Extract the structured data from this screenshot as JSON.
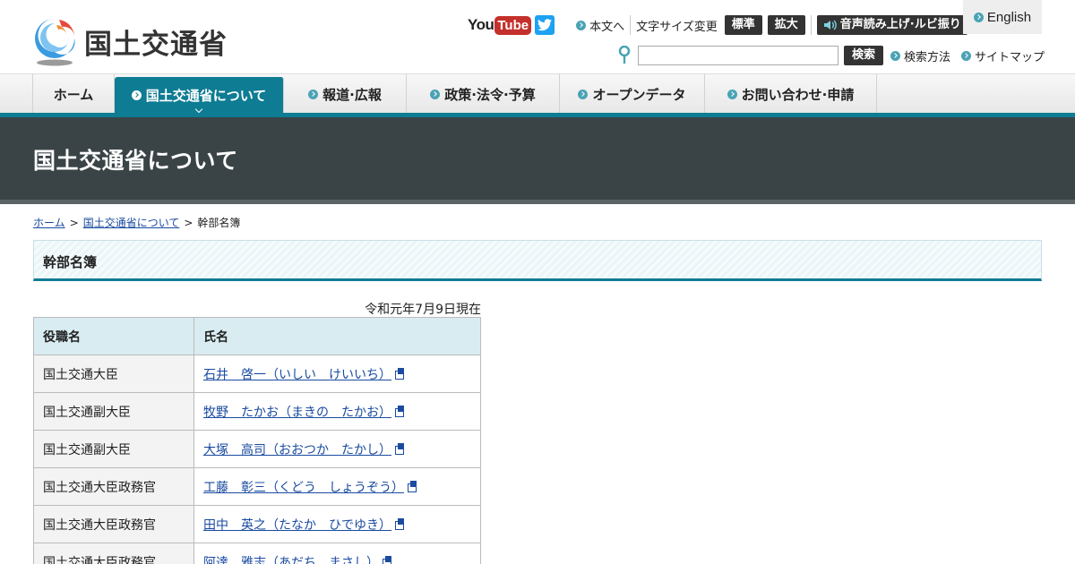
{
  "header": {
    "logo_text": "国土交通省",
    "youtube_you": "You",
    "youtube_tube": "Tube",
    "skip_link": "本文へ",
    "font_size_label": "文字サイズ変更",
    "font_standard": "標準",
    "font_large": "拡大",
    "voice_label": "音声読み上げ·ルビ振り",
    "english": "English",
    "search_button": "検索",
    "search_method": "検索方法",
    "sitemap": "サイトマップ",
    "search_placeholder": ""
  },
  "nav": {
    "items": [
      {
        "label": "ホーム"
      },
      {
        "label": "国土交通省について"
      },
      {
        "label": "報道·広報"
      },
      {
        "label": "政策·法令·予算"
      },
      {
        "label": "オープンデータ"
      },
      {
        "label": "お問い合わせ·申請"
      }
    ]
  },
  "banner": {
    "title": "国土交通省について"
  },
  "breadcrumb": {
    "home": "ホーム",
    "sep": ">",
    "about": "国土交通省について",
    "current": "幹部名簿"
  },
  "section": {
    "title": "幹部名簿",
    "as_of": "令和元年7月9日現在"
  },
  "table": {
    "headers": [
      "役職名",
      "氏名"
    ],
    "rows": [
      {
        "role": "国土交通大臣",
        "name": "石井　啓一（いしい　けいいち）"
      },
      {
        "role": "国土交通副大臣",
        "name": "牧野　たかお（まきの　たかお）"
      },
      {
        "role": "国土交通副大臣",
        "name": "大塚　高司（おおつか　たかし）"
      },
      {
        "role": "国土交通大臣政務官",
        "name": "工藤　彰三（くどう　しょうぞう）"
      },
      {
        "role": "国土交通大臣政務官",
        "name": "田中　英之（たなか　ひでゆき）"
      },
      {
        "role": "国土交通大臣政務官",
        "name": "阿達　雅志（あだち　まさし）"
      }
    ]
  },
  "colors": {
    "accent": "#0e7c93",
    "banner": "#3a4447",
    "link": "#1a4ba0"
  }
}
